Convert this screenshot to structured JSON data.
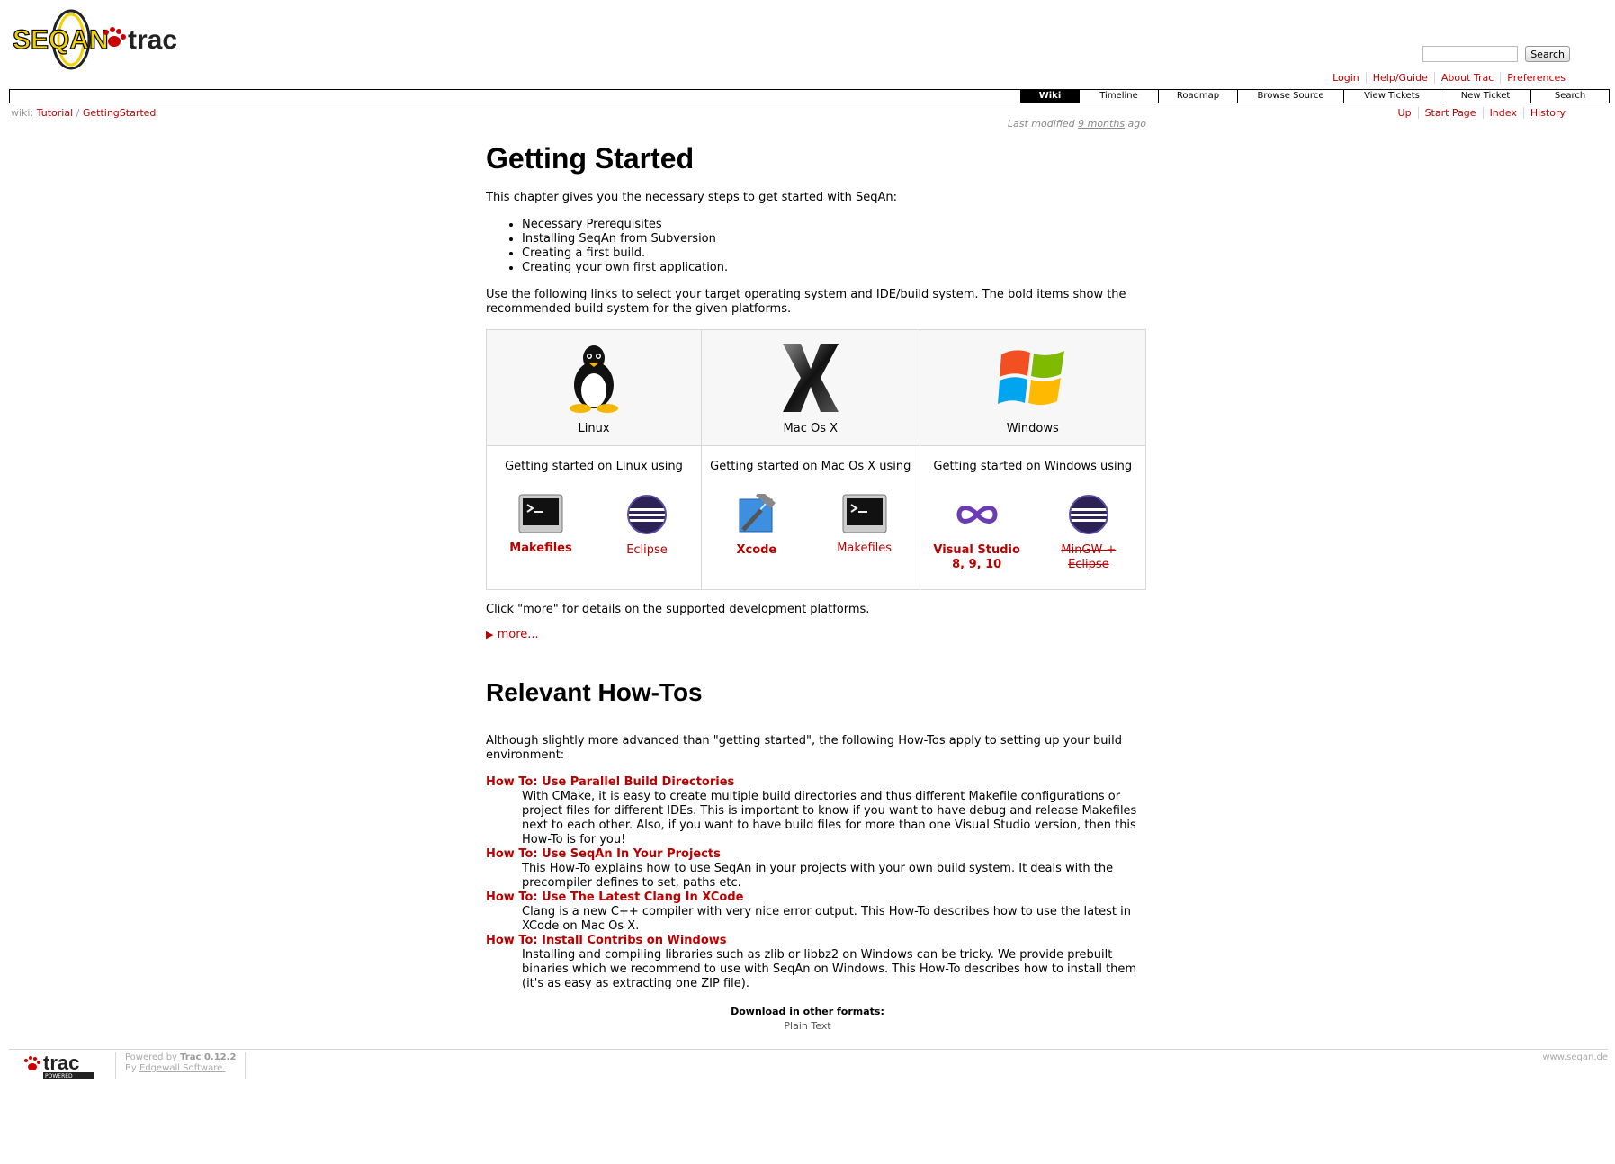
{
  "header": {
    "logo_text_1": "SEQAN",
    "logo_text_2": "trac",
    "search_button": "Search",
    "metanav": [
      "Login",
      "Help/Guide",
      "About Trac",
      "Preferences"
    ]
  },
  "mainnav": {
    "tabs": [
      "Wiki",
      "Timeline",
      "Roadmap",
      "Browse Source",
      "View Tickets",
      "New Ticket",
      "Search"
    ],
    "active": "Wiki"
  },
  "breadcrumb": {
    "prefix": "wiki:",
    "items": [
      "Tutorial",
      "GettingStarted"
    ],
    "separator": "/"
  },
  "ctxnav": [
    "Up",
    "Start Page",
    "Index",
    "History"
  ],
  "content": {
    "last_modified_prefix": "Last modified",
    "last_modified_value": "9 months",
    "last_modified_suffix": "ago",
    "title": "Getting Started",
    "intro": "This chapter gives you the necessary steps to get started with SeqAn:",
    "steps": [
      "Necessary Prerequisites",
      "Installing SeqAn from Subversion",
      "Creating a first build.",
      "Creating your own first application."
    ],
    "select_text": "Use the following links to select your target operating system and IDE/build system. The bold items show the recommended build system for the given platforms.",
    "platforms": [
      {
        "os": "Linux",
        "heading": "Getting started on Linux using",
        "icon": "tux-icon",
        "ides": [
          {
            "label": "Makefiles",
            "icon": "terminal-icon",
            "bold": true
          },
          {
            "label": "Eclipse",
            "icon": "eclipse-icon",
            "bold": false
          }
        ]
      },
      {
        "os": "Mac Os X",
        "heading": "Getting started on Mac Os X using",
        "icon": "mac-x-icon",
        "ides": [
          {
            "label": "Xcode",
            "icon": "xcode-icon",
            "bold": true
          },
          {
            "label": "Makefiles",
            "icon": "terminal-icon",
            "bold": false
          }
        ]
      },
      {
        "os": "Windows",
        "heading": "Getting started on Windows using",
        "icon": "windows-icon",
        "ides": [
          {
            "label": "Visual Studio 8, 9, 10",
            "icon": "visual-studio-icon",
            "bold": true
          },
          {
            "label": "MinGW + Eclipse",
            "icon": "eclipse-icon",
            "bold": false,
            "strike": true
          }
        ]
      }
    ],
    "more_text": "Click \"more\" for details on the supported development platforms.",
    "more_link": "more...",
    "howtos_title": "Relevant How-Tos",
    "howtos_intro": "Although slightly more advanced than \"getting started\", the following How-Tos apply to setting up your build environment:",
    "howtos": [
      {
        "title": "How To: Use Parallel Build Directories",
        "desc": "With CMake, it is easy to create multiple build directories and thus different Makefile configurations or project files for different IDEs. This is important to know if you want to have debug and release Makefiles next to each other. Also, if you want to have build files for more than one Visual Studio version, then this How-To is for you!"
      },
      {
        "title": "How To: Use SeqAn In Your Projects",
        "desc": "This How-To explains how to use SeqAn in your projects with your own build system. It deals with the precompiler defines to set, paths etc."
      },
      {
        "title": "How To: Use The Latest Clang In XCode",
        "desc": "Clang is a new C++ compiler with very nice error output. This How-To describes how to use the latest in XCode on Mac Os X."
      },
      {
        "title": "How To: Install Contribs on Windows",
        "desc": "Installing and compiling libraries such as zlib or libbz2 on Windows can be tricky. We provide prebuilt binaries which we recommend to use with SeqAn on Windows. This How-To describes how to install them (it's as easy as extracting one ZIP file)."
      }
    ]
  },
  "altlinks": {
    "heading": "Download in other formats:",
    "link": "Plain Text"
  },
  "footer": {
    "logo_text": "trac",
    "logo_sub": "POWERED",
    "powered_prefix": "Powered by",
    "powered_product": "Trac 0.12.2",
    "by_prefix": "By",
    "by_name": "Edgewall Software.",
    "site_url": "www.seqan.de"
  },
  "colors": {
    "link": "#bb0000",
    "logo_yellow": "#f2d100",
    "border": "#d7d7d7"
  }
}
